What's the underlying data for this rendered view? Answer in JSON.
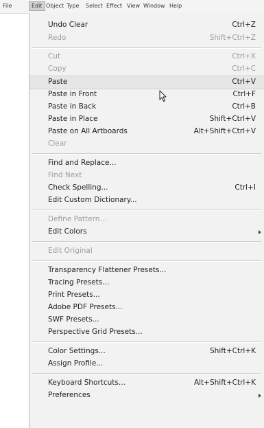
{
  "menubar": {
    "items": [
      "File",
      "Edit",
      "Object",
      "Type",
      "Select",
      "Effect",
      "View",
      "Window",
      "Help"
    ],
    "active": "Edit"
  },
  "menu": {
    "undo": {
      "label": "Undo Clear",
      "shortcut": "Ctrl+Z"
    },
    "redo": {
      "label": "Redo",
      "shortcut": "Shift+Ctrl+Z"
    },
    "cut": {
      "label": "Cut",
      "shortcut": "Ctrl+X"
    },
    "copy": {
      "label": "Copy",
      "shortcut": "Ctrl+C"
    },
    "paste": {
      "label": "Paste",
      "shortcut": "Ctrl+V"
    },
    "paste_front": {
      "label": "Paste in Front",
      "shortcut": "Ctrl+F"
    },
    "paste_back": {
      "label": "Paste in Back",
      "shortcut": "Ctrl+B"
    },
    "paste_place": {
      "label": "Paste in Place",
      "shortcut": "Shift+Ctrl+V"
    },
    "paste_all": {
      "label": "Paste on All Artboards",
      "shortcut": "Alt+Shift+Ctrl+V"
    },
    "clear": {
      "label": "Clear"
    },
    "find_replace": {
      "label": "Find and Replace..."
    },
    "find_next": {
      "label": "Find Next"
    },
    "check_spelling": {
      "label": "Check Spelling...",
      "shortcut": "Ctrl+I"
    },
    "edit_dictionary": {
      "label": "Edit Custom Dictionary..."
    },
    "define_pattern": {
      "label": "Define Pattern..."
    },
    "edit_colors": {
      "label": "Edit Colors"
    },
    "edit_original": {
      "label": "Edit Original"
    },
    "transparency_presets": {
      "label": "Transparency Flattener Presets..."
    },
    "tracing_presets": {
      "label": "Tracing Presets..."
    },
    "print_presets": {
      "label": "Print Presets..."
    },
    "pdf_presets": {
      "label": "Adobe PDF Presets..."
    },
    "swf_presets": {
      "label": "SWF Presets..."
    },
    "perspective_presets": {
      "label": "Perspective Grid Presets..."
    },
    "color_settings": {
      "label": "Color Settings...",
      "shortcut": "Shift+Ctrl+K"
    },
    "assign_profile": {
      "label": "Assign Profile..."
    },
    "keyboard_shortcuts": {
      "label": "Keyboard Shortcuts...",
      "shortcut": "Alt+Shift+Ctrl+K"
    },
    "preferences": {
      "label": "Preferences"
    }
  },
  "colors": {
    "menu_bg": "#f2f2f2",
    "disabled_text": "#9c9c9c",
    "hover_bg": "#e6e6e6"
  },
  "icons": {
    "cursor": "mouse-pointer-icon",
    "submenu": "submenu-arrow-icon"
  }
}
